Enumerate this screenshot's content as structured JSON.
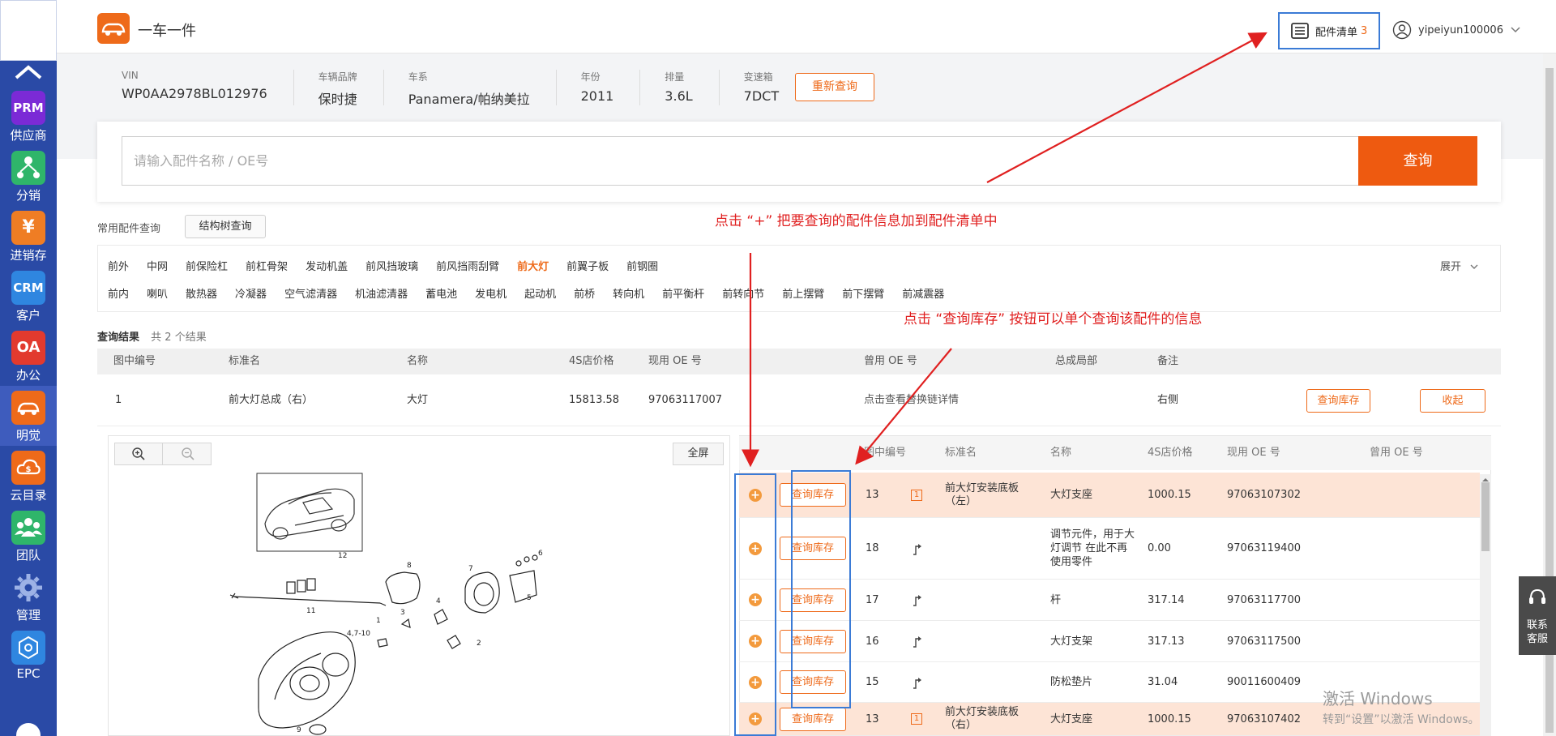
{
  "sidebar": {
    "items": [
      {
        "icon": "PRM",
        "label": "供应商",
        "color": "#7b2ad6"
      },
      {
        "icon": "distribution-icon",
        "label": "分销",
        "color": "#2fb56a"
      },
      {
        "icon": "¥",
        "label": "进销存",
        "color": "#ef7d24"
      },
      {
        "icon": "CRM",
        "label": "客户",
        "color": "#2f86e0"
      },
      {
        "icon": "OA",
        "label": "办公",
        "color": "#e23a2e"
      },
      {
        "icon": "car-icon",
        "label": "明觉",
        "color": "#ee6a1a"
      },
      {
        "icon": "cloud-catalog-icon",
        "label": "云目录",
        "color": "#ee6a1a"
      },
      {
        "icon": "team-icon",
        "label": "团队",
        "color": "#2fb56a"
      },
      {
        "icon": "gear-icon",
        "label": "管理",
        "color": "#8fa6dd"
      },
      {
        "icon": "EPC",
        "label": "EPC",
        "color": "#2f86e0"
      }
    ]
  },
  "header": {
    "brand": "一车一件",
    "parts_list_label": "配件清单",
    "parts_list_count": "3",
    "username": "yipeiyun100006"
  },
  "vehicle": {
    "fields": [
      {
        "key": "VIN",
        "value": "WP0AA2978BL012976"
      },
      {
        "key": "车辆品牌",
        "value": "保时捷"
      },
      {
        "key": "车系",
        "value": "Panamera/帕纳美拉"
      },
      {
        "key": "年份",
        "value": "2011"
      },
      {
        "key": "排量",
        "value": "3.6L"
      },
      {
        "key": "变速箱",
        "value": "7DCT"
      }
    ],
    "requery_label": "重新查询"
  },
  "search": {
    "placeholder": "请输入配件名称 / OE号",
    "button": "查询"
  },
  "common": {
    "label": "常用配件查询",
    "tree_button": "结构树查询",
    "row1": [
      "前外",
      "中网",
      "前保险杠",
      "前杠骨架",
      "发动机盖",
      "前风挡玻璃",
      "前风挡雨刮臂",
      "前大灯",
      "前翼子板",
      "前钢圈"
    ],
    "row1_active": "前大灯",
    "row2": [
      "前内",
      "喇叭",
      "散热器",
      "冷凝器",
      "空气滤清器",
      "机油滤清器",
      "蓄电池",
      "发电机",
      "起动机",
      "前桥",
      "转向机",
      "前平衡杆",
      "前转向节",
      "前上摆臂",
      "前下摆臂",
      "前减震器"
    ],
    "expand_label": "展开"
  },
  "results": {
    "label": "查询结果",
    "count": "共 2 个结果",
    "headers": [
      "图中编号",
      "标准名",
      "名称",
      "4S店价格",
      "现用 OE 号",
      "曾用 OE 号",
      "总成局部",
      "备注"
    ],
    "row": {
      "num": "1",
      "std_name": "前大灯总成（右）",
      "name": "大灯",
      "price": "15813.58",
      "oe": "97063117007",
      "old_oe": "点击查看替换链详情",
      "note": "右侧",
      "query_stock": "查询库存",
      "collapse": "收起"
    }
  },
  "diagram": {
    "fullscreen": "全屏",
    "labels": [
      "12",
      "11",
      "8",
      "7",
      "6",
      "5",
      "4",
      "3",
      "2",
      "4,7-10",
      "9",
      "1"
    ]
  },
  "parts": {
    "headers": [
      "图中编号",
      "标准名",
      "名称",
      "4S店价格",
      "现用 OE 号",
      "曾用 OE 号"
    ],
    "stock_btn": "查询库存",
    "rows": [
      {
        "num": "13",
        "marker": "1",
        "std": "前大灯安装底板（左）",
        "name": "大灯支座",
        "price": "1000.15",
        "oe": "97063107302",
        "hl": true
      },
      {
        "num": "18",
        "marker": "arrow",
        "std": "",
        "name": "调节元件，用于大灯调节 在此不再使用零件",
        "price": "0.00",
        "oe": "97063119400",
        "hl": false
      },
      {
        "num": "17",
        "marker": "arrow",
        "std": "",
        "name": "杆",
        "price": "317.14",
        "oe": "97063117700",
        "hl": false
      },
      {
        "num": "16",
        "marker": "arrow",
        "std": "",
        "name": "大灯支架",
        "price": "317.13",
        "oe": "97063117500",
        "hl": false
      },
      {
        "num": "15",
        "marker": "arrow",
        "std": "",
        "name": "防松垫片",
        "price": "31.04",
        "oe": "90011600409",
        "hl": false
      },
      {
        "num": "13",
        "marker": "1",
        "std": "前大灯安装底板（右）",
        "name": "大灯支座",
        "price": "1000.15",
        "oe": "97063107402",
        "hl": true
      }
    ]
  },
  "help": {
    "label": "联系客服"
  },
  "watermark": {
    "line1": "激活 Windows",
    "line2": "转到“设置”以激活 Windows。"
  },
  "annotations": {
    "add_tip": "点击 “+” 把要查询的配件信息加到配件清单中",
    "stock_tip": "点击 “查询库存” 按钮可以单个查询该配件的信息"
  },
  "colors": {
    "accent": "#ee6a1a",
    "sidebar": "#2a4aa6",
    "annotation": "#e02020",
    "highlight_box": "#3b7bd6"
  }
}
